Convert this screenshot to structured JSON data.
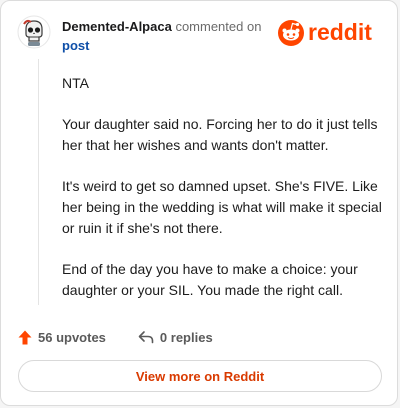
{
  "comment": {
    "author": "Demented-Alpaca",
    "action_text": "commented on",
    "target_link": "post",
    "paragraphs": [
      "NTA",
      "Your daughter said no. Forcing her to do it just tells her that her wishes and wants don't matter.",
      "It's weird to get so damned upset. She's FIVE. Like her being in the wedding is what will make it special or ruin it if she's not there.",
      "End of the day you have to make a choice: your daughter or your SIL. You made the right call."
    ]
  },
  "brand": {
    "logo_text": "reddit",
    "color": "#ff4500"
  },
  "stats": {
    "upvotes_label": "56 upvotes",
    "replies_label": "0 replies"
  },
  "footer": {
    "view_more_label": "View more on Reddit"
  },
  "icons": {
    "avatar": "skull-avatar-icon",
    "logo": "reddit-snoo-icon",
    "upvote": "upvote-arrow-icon",
    "reply": "reply-arrow-icon"
  }
}
